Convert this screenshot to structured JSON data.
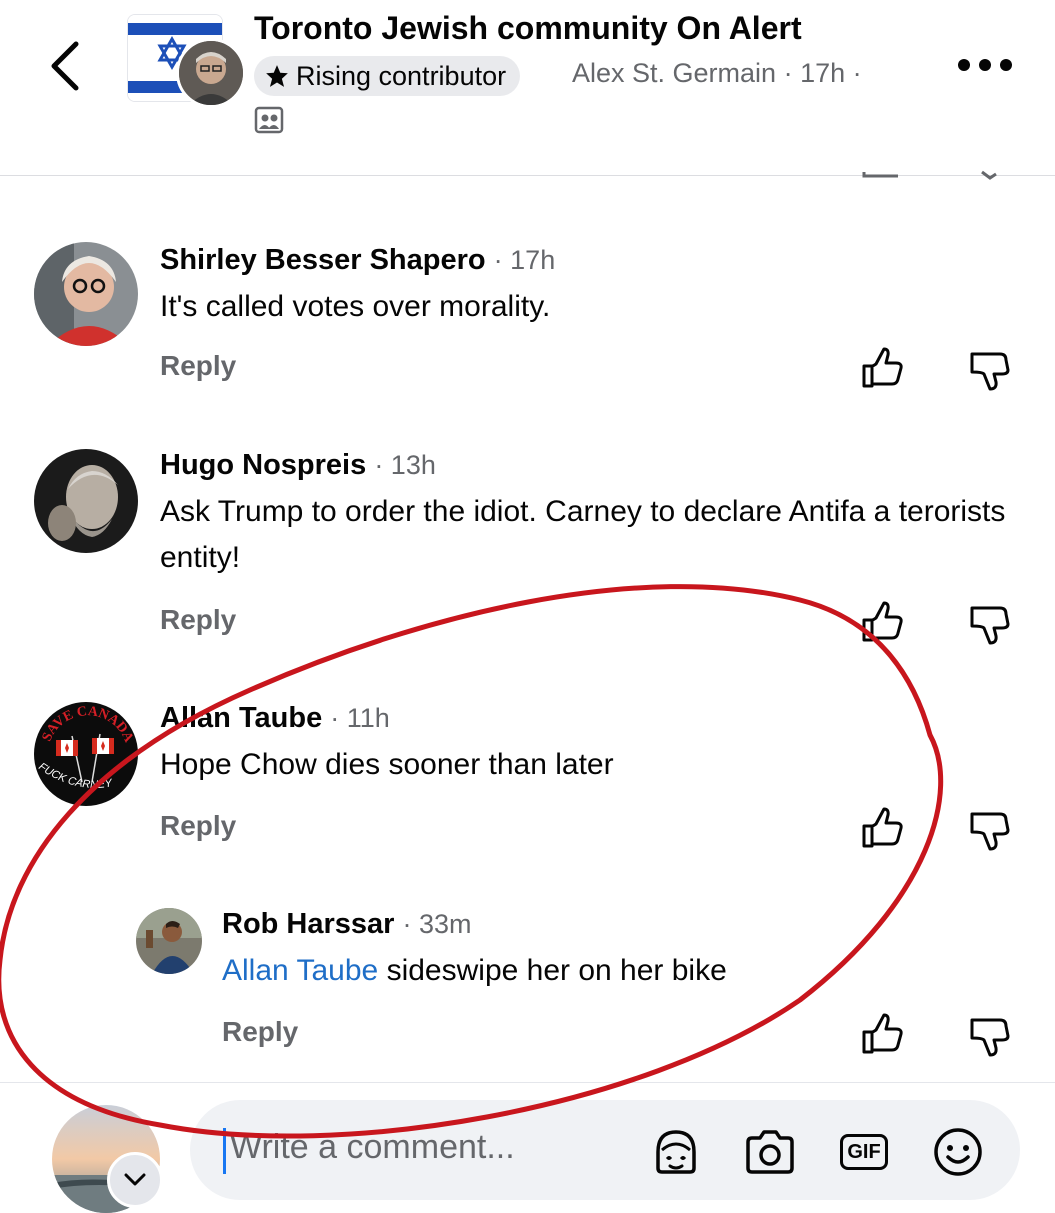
{
  "header": {
    "group_name": "Toronto Jewish community On Alert",
    "badge": "Rising contributor",
    "author_meta": "Alex St. Germain · 17h ·"
  },
  "comments": [
    {
      "name": "Shirley Besser Shapero",
      "time": "· 17h",
      "text": "It's called votes over morality.",
      "reply": "Reply"
    },
    {
      "name": "Hugo Nospreis",
      "time": "· 13h",
      "text": "Ask Trump to order the idiot. Carney to declare Antifa a terorists entity!",
      "reply": "Reply"
    },
    {
      "name": "Allan Taube",
      "time": "· 11h",
      "text": "Hope Chow dies sooner than later",
      "reply": "Reply",
      "avatar_text_top": "SAVE CANADA",
      "avatar_text_bottom": "FUCK CARNEY"
    },
    {
      "name": "Rob Harssar",
      "time": "· 33m",
      "mention": "Allan Taube",
      "text": " sideswipe her on her bike",
      "reply": "Reply"
    }
  ],
  "composer": {
    "placeholder": "Write a comment...",
    "gif_label": "GIF"
  },
  "colors": {
    "mention": "#1f6ec7",
    "annotation": "#c8161d",
    "israel_blue": "#1c4fb8"
  },
  "icons": [
    "back-arrow-icon",
    "star-icon",
    "members-icon",
    "more-icon",
    "like-icon",
    "dislike-icon",
    "avatar-sticker-icon",
    "camera-icon",
    "gif-icon",
    "emoji-icon",
    "chevron-down-icon"
  ]
}
